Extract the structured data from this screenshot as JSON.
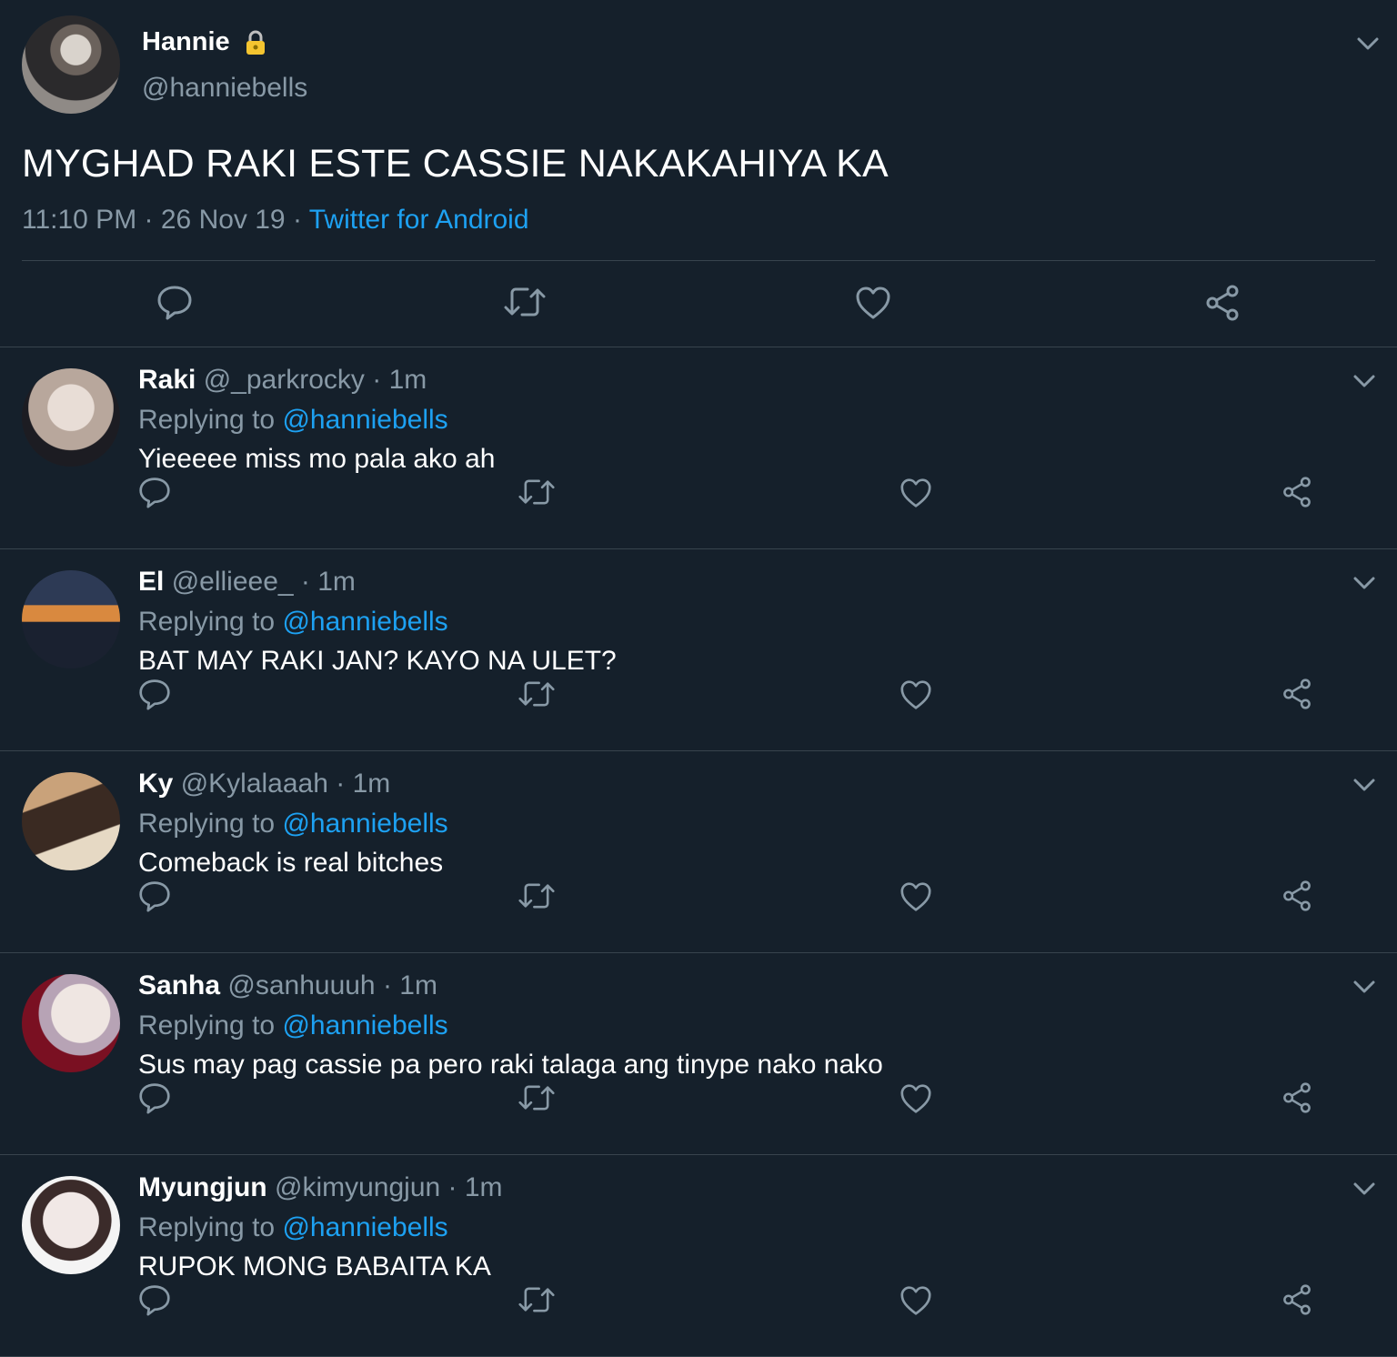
{
  "main_tweet": {
    "author_name": "Hannie",
    "author_handle": "@hanniebells",
    "text": "MYGHAD RAKI ESTE CASSIE NAKAKAHIYA KA",
    "time": "11:10 PM",
    "date": "26 Nov 19",
    "source": "Twitter for Android",
    "meta_separator": " · ",
    "icons": [
      "lock-icon",
      "chevron-down-icon",
      "reply-icon",
      "retweet-icon",
      "like-icon",
      "share-icon"
    ]
  },
  "replying_to_label": "Replying to",
  "replies": [
    {
      "name": "Raki",
      "handle": "@_parkrocky",
      "time": "1m",
      "replying_to": "@hanniebells",
      "text": "Yieeeee miss mo pala ako ah"
    },
    {
      "name": "El",
      "handle": "@ellieee_",
      "time": "1m",
      "replying_to": "@hanniebells",
      "text": "BAT MAY RAKI JAN? KAYO NA ULET?"
    },
    {
      "name": "Ky",
      "handle": "@Kylalaaah",
      "time": "1m",
      "replying_to": "@hanniebells",
      "text": "Comeback is real bitches"
    },
    {
      "name": "Sanha",
      "handle": "@sanhuuuh",
      "time": "1m",
      "replying_to": "@hanniebells",
      "text": "Sus may pag cassie pa pero raki talaga ang tinype nako nako"
    },
    {
      "name": "Myungjun",
      "handle": "@kimyungjun",
      "time": "1m",
      "replying_to": "@hanniebells",
      "text": "RUPOK MONG BABAITA KA"
    }
  ],
  "colors": {
    "background": "#15202b",
    "divider": "#38444d",
    "secondary_text": "#8899a6",
    "link": "#1da1f2",
    "primary_text": "#ffffff"
  }
}
